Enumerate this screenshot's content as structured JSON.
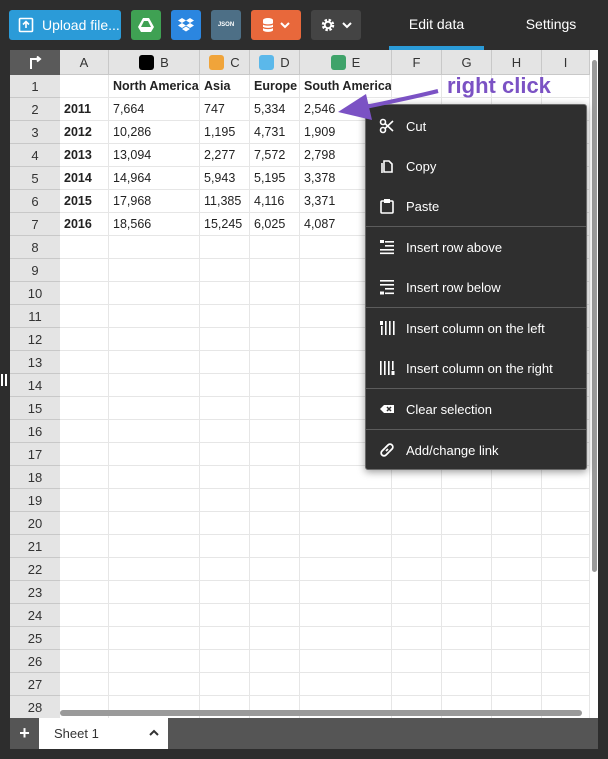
{
  "toolbar": {
    "upload_label": "Upload file...",
    "json_label": "JSON",
    "tabs": {
      "edit": "Edit data",
      "settings": "Settings"
    }
  },
  "sheet": {
    "columns": [
      {
        "letter": "A",
        "color": null
      },
      {
        "letter": "B",
        "color": "#000000"
      },
      {
        "letter": "C",
        "color": "#f0a43a"
      },
      {
        "letter": "D",
        "color": "#5bb8ea"
      },
      {
        "letter": "E",
        "color": "#3fa36a"
      },
      {
        "letter": "F",
        "color": null
      },
      {
        "letter": "G",
        "color": null
      },
      {
        "letter": "H",
        "color": null
      },
      {
        "letter": "I",
        "color": null
      }
    ],
    "row_numbers": [
      "1",
      "2",
      "3",
      "4",
      "5",
      "6",
      "7",
      "8",
      "9",
      "10",
      "11",
      "12",
      "13",
      "14",
      "15",
      "16",
      "17",
      "18",
      "19",
      "20",
      "21",
      "22",
      "23",
      "24",
      "25",
      "26",
      "27",
      "28"
    ],
    "header_row": [
      "",
      "North America",
      "Asia",
      "Europe",
      "South America"
    ],
    "rows": [
      [
        "2011",
        "7,664",
        "747",
        "5,334",
        "2,546"
      ],
      [
        "2012",
        "10,286",
        "1,195",
        "4,731",
        "1,909"
      ],
      [
        "2013",
        "13,094",
        "2,277",
        "7,572",
        "2,798"
      ],
      [
        "2014",
        "14,964",
        "5,943",
        "5,195",
        "3,378"
      ],
      [
        "2015",
        "17,968",
        "11,385",
        "4,116",
        "3,371"
      ],
      [
        "2016",
        "18,566",
        "15,245",
        "6,025",
        "4,087"
      ]
    ],
    "tab_name": "Sheet 1",
    "add_label": "+"
  },
  "context_menu": {
    "items": [
      {
        "label": "Cut",
        "icon": "scissors-icon"
      },
      {
        "label": "Copy",
        "icon": "copy-icon"
      },
      {
        "label": "Paste",
        "icon": "paste-icon"
      },
      {
        "label": "Insert row above",
        "icon": "insert-row-above-icon"
      },
      {
        "label": "Insert row below",
        "icon": "insert-row-below-icon"
      },
      {
        "label": "Insert column on the left",
        "icon": "insert-column-left-icon"
      },
      {
        "label": "Insert column on the right",
        "icon": "insert-column-right-icon"
      },
      {
        "label": "Clear selection",
        "icon": "clear-icon"
      },
      {
        "label": "Add/change link",
        "icon": "link-icon"
      }
    ]
  },
  "annotation": {
    "text": "right click",
    "color": "#7b52c4"
  },
  "colors": {
    "accent": "#2b9bd8",
    "toolbar_bg": "#2d2d2d",
    "menu_bg": "#2f2f2f"
  }
}
